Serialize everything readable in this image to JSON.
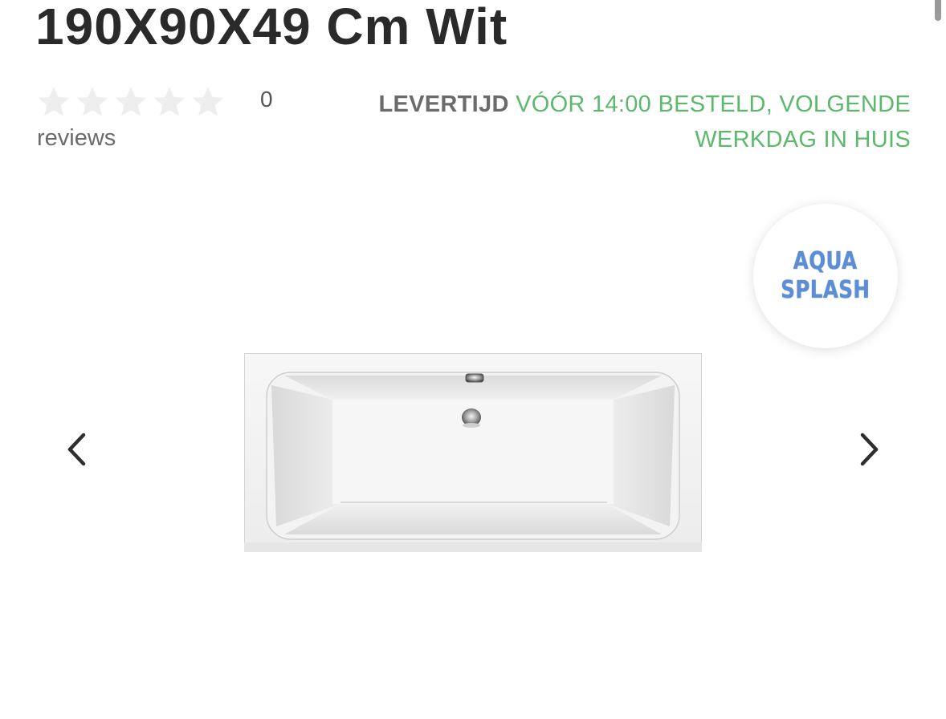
{
  "product": {
    "title": "190X90X49 Cm Wit"
  },
  "rating": {
    "stars_filled": 0,
    "stars_total": 5,
    "count": "0",
    "label": "reviews",
    "star_color_empty": "#eeeeee"
  },
  "delivery": {
    "label": "LEVERTIJD",
    "value": "VÓÓR 14:00 BESTELD, VOLGENDE WERKDAG IN HUIS",
    "value_color": "#5cb96b"
  },
  "brand": {
    "line1": "AQUA",
    "line2": "SPLASH",
    "color": "#5b8ed6"
  },
  "gallery": {
    "prev_icon": "chevron-left-icon",
    "next_icon": "chevron-right-icon",
    "image_subject": "white rectangular bathtub, top view"
  }
}
